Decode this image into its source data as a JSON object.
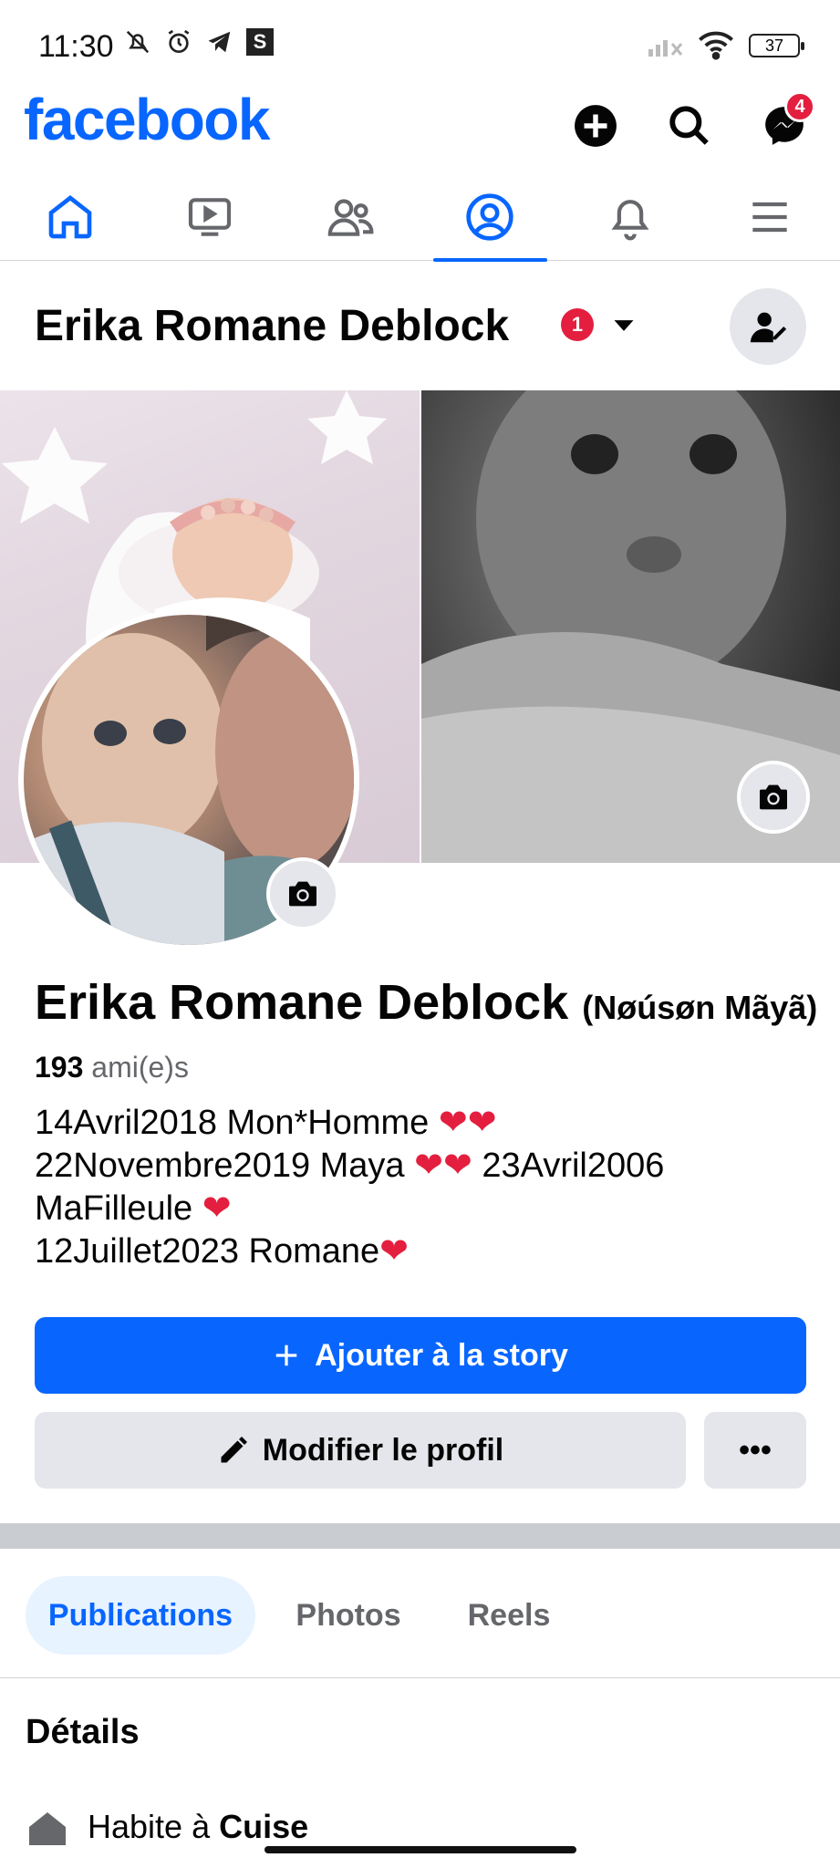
{
  "status_bar": {
    "time": "11:30",
    "s_badge": "S",
    "battery": "37"
  },
  "app": {
    "logo": "facebook",
    "messenger_count": "4"
  },
  "header": {
    "name": "Erika Romane Deblock",
    "notif_count": "1"
  },
  "profile": {
    "name": "Erika Romane Deblock",
    "alt_name": "(Nøúsøn Mãyã)",
    "friends_count": "193",
    "friends_label": "ami(e)s",
    "bio": [
      {
        "text": "14Avril2018 Mon*Homme ",
        "hearts": "❤❤"
      },
      {
        "text": "22Novembre2019 Maya ",
        "hearts": "❤❤",
        "after": " 23Avril2006"
      },
      {
        "text": "MaFilleule ",
        "hearts": "❤"
      },
      {
        "text": "12Juillet2023 Romane",
        "hearts": "❤"
      }
    ]
  },
  "actions": {
    "add_story": "Ajouter à la story",
    "edit_profile": "Modifier le profil",
    "more": "•••"
  },
  "profile_tabs": [
    "Publications",
    "Photos",
    "Reels"
  ],
  "details": {
    "title": "Détails",
    "lives_prefix": "Habite à",
    "lives_city": "Cuise"
  },
  "colors": {
    "brand": "#0866ff",
    "badge": "#e41e3f",
    "button_gray": "#e4e6eb"
  }
}
